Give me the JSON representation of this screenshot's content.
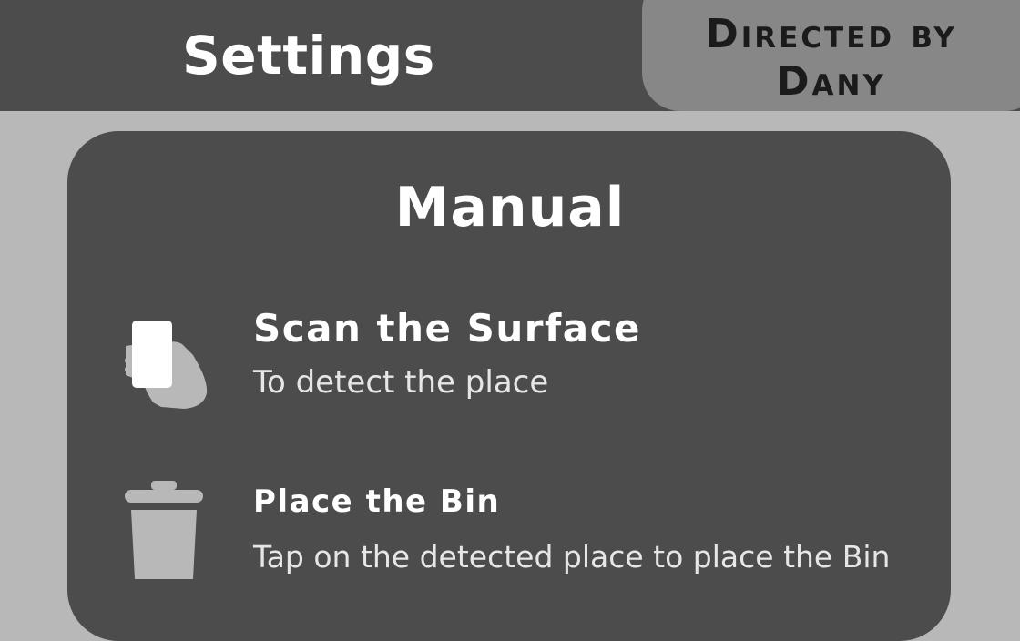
{
  "header": {
    "title": "Settings",
    "credit": "Directed by Dany"
  },
  "manual": {
    "title": "Manual",
    "steps": [
      {
        "icon": "phone-in-hand-icon",
        "heading": "Scan the Surface",
        "description": "To detect the place"
      },
      {
        "icon": "trash-bin-icon",
        "heading": "Place the Bin",
        "description": "Tap on the detected place to place the Bin"
      }
    ]
  }
}
